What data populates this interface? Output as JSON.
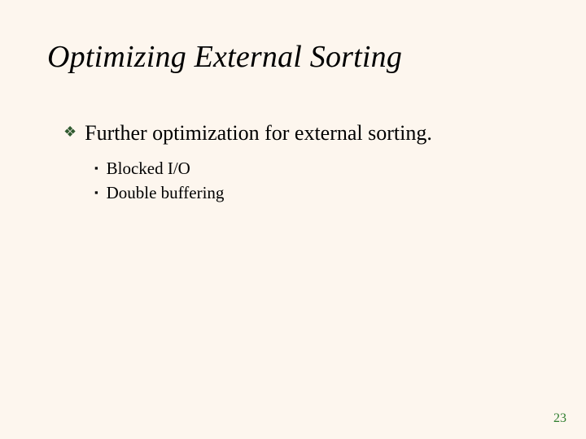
{
  "title": "Optimizing External Sorting",
  "bullets": {
    "l1": "Further optimization for external sorting.",
    "l2a": "Blocked I/O",
    "l2b": "Double buffering"
  },
  "pageNumber": "23"
}
